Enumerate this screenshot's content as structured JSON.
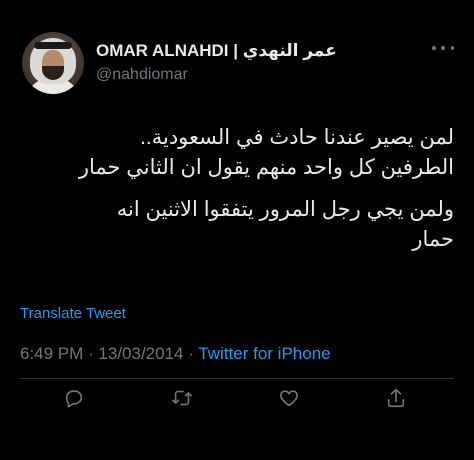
{
  "author": {
    "display_name": "OMAR ALNAHDI | عمر النهدي",
    "handle": "@nahdiomar"
  },
  "tweet": {
    "lines": [
      "لمن يصير عندنا حادث في السعودية..",
      "الطرفين كل واحد منهم يقول ان الثاني حمار",
      "ولمن يجي رجل المرور يتفقوا الاثنين انه",
      "حمار"
    ]
  },
  "translate_label": "Translate Tweet",
  "meta": {
    "time": "6:49 PM",
    "separator": " · ",
    "date": "13/03/2014",
    "separator2": " · ",
    "source": "Twitter for iPhone"
  },
  "icons": {
    "more": "more-horizontal-icon",
    "reply": "reply-icon",
    "retweet": "retweet-icon",
    "like": "like-heart-icon",
    "share": "share-icon"
  },
  "colors": {
    "background": "#000000",
    "text": "#e7e9ea",
    "secondary": "#71767b",
    "accent": "#1d9bf0"
  }
}
